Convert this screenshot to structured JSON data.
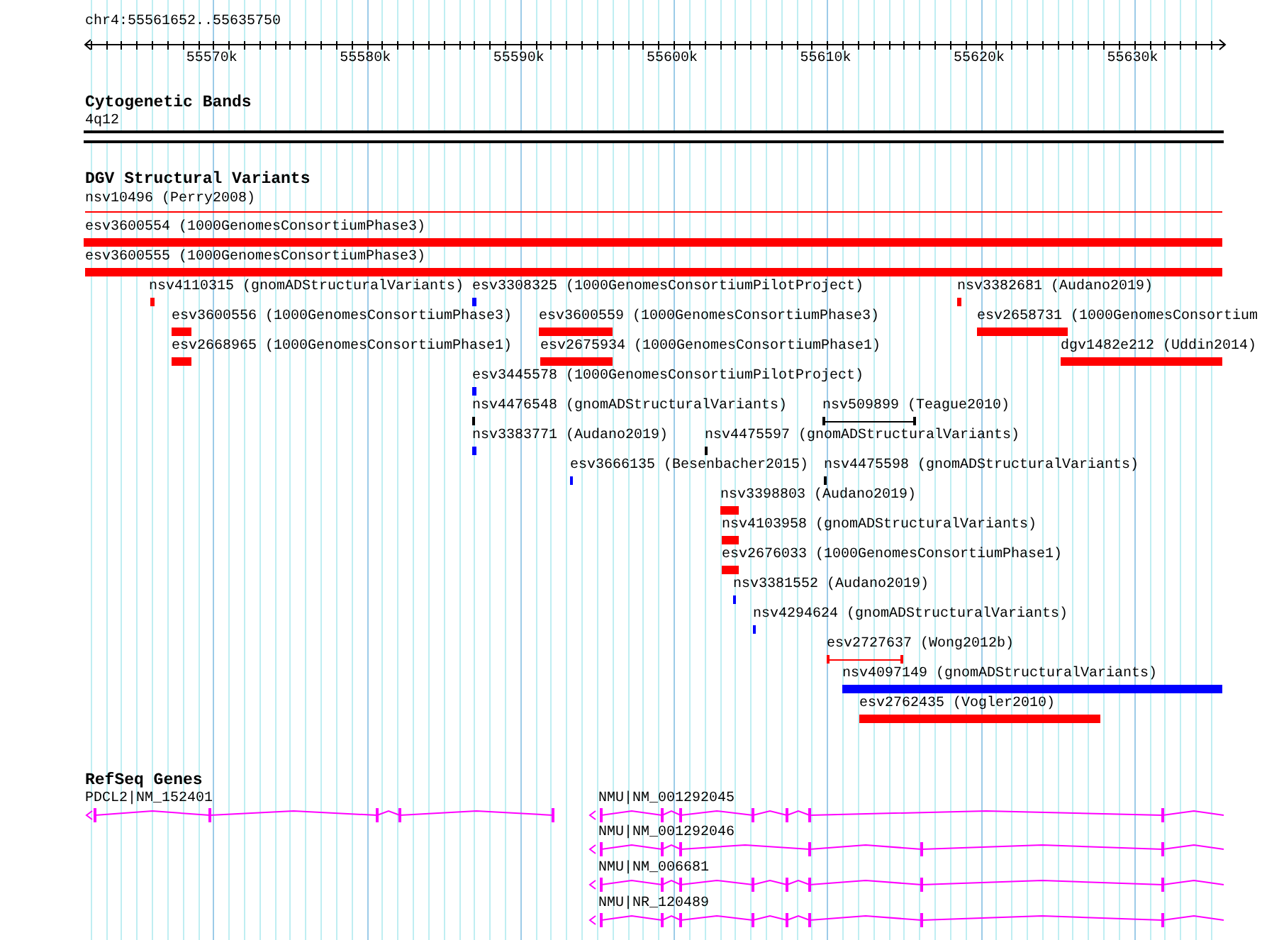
{
  "ruler": {
    "location": "chr4:55561652..55635750",
    "tick_labels": [
      "55570k",
      "55580k",
      "55590k",
      "55600k",
      "55610k",
      "55620k",
      "55630k"
    ]
  },
  "cytogenetic_bands": {
    "title": "Cytogenetic Bands",
    "band": "4q12"
  },
  "dgv_track": {
    "title": "DGV Structural Variants",
    "features": [
      {
        "label": "nsv10496 (Perry2008)",
        "kind": "line",
        "color": "#ff0000"
      },
      {
        "label": "esv3600554 (1000GenomesConsortiumPhase3)",
        "kind": "bar",
        "color": "#ff0000"
      },
      {
        "label": "esv3600555 (1000GenomesConsortiumPhase3)",
        "kind": "bar",
        "color": "#ff0000"
      },
      {
        "label": "nsv4110315 (gnomADStructuralVariants)",
        "kind": "bar",
        "color": "#ff0000"
      },
      {
        "label": "esv3308325 (1000GenomesConsortiumPilotProject)",
        "kind": "bar",
        "color": "#0000ff"
      },
      {
        "label": "nsv3382681 (Audano2019)",
        "kind": "bar",
        "color": "#ff0000"
      },
      {
        "label": "esv3600556 (1000GenomesConsortiumPhase3)",
        "kind": "bar",
        "color": "#ff0000"
      },
      {
        "label": "esv3600559 (1000GenomesConsortiumPhase3)",
        "kind": "bar",
        "color": "#ff0000"
      },
      {
        "label": "esv2658731 (1000GenomesConsortium",
        "kind": "bar",
        "color": "#ff0000"
      },
      {
        "label": "esv2668965 (1000GenomesConsortiumPhase1)",
        "kind": "bar",
        "color": "#ff0000"
      },
      {
        "label": "esv2675934 (1000GenomesConsortiumPhase1)",
        "kind": "bar",
        "color": "#ff0000"
      },
      {
        "label": "dgv1482e212 (Uddin2014)",
        "kind": "bar",
        "color": "#ff0000"
      },
      {
        "label": "esv3445578 (1000GenomesConsortiumPilotProject)",
        "kind": "bar",
        "color": "#0000ff"
      },
      {
        "label": "nsv4476548 (gnomADStructuralVariants)",
        "kind": "bar",
        "color": "#000000"
      },
      {
        "label": "nsv509899 (Teague2010)",
        "kind": "range",
        "color": "#000000"
      },
      {
        "label": "nsv3383771 (Audano2019)",
        "kind": "bar",
        "color": "#0000ff"
      },
      {
        "label": "nsv4475597 (gnomADStructuralVariants)",
        "kind": "bar",
        "color": "#000000"
      },
      {
        "label": "esv3666135 (Besenbacher2015)",
        "kind": "bar",
        "color": "#0000ff"
      },
      {
        "label": "nsv4475598 (gnomADStructuralVariants)",
        "kind": "bar",
        "color": "#000000"
      },
      {
        "label": "nsv3398803 (Audano2019)",
        "kind": "bar",
        "color": "#ff0000"
      },
      {
        "label": "nsv4103958 (gnomADStructuralVariants)",
        "kind": "bar",
        "color": "#ff0000"
      },
      {
        "label": "esv2676033 (1000GenomesConsortiumPhase1)",
        "kind": "bar",
        "color": "#ff0000"
      },
      {
        "label": "nsv3381552 (Audano2019)",
        "kind": "bar",
        "color": "#0000ff"
      },
      {
        "label": "nsv4294624 (gnomADStructuralVariants)",
        "kind": "bar",
        "color": "#0000ff"
      },
      {
        "label": "esv2727637 (Wong2012b)",
        "kind": "range",
        "color": "#ff0000"
      },
      {
        "label": "nsv4097149 (gnomADStructuralVariants)",
        "kind": "bar",
        "color": "#0000ff"
      },
      {
        "label": "esv2762435 (Vogler2010)",
        "kind": "bar",
        "color": "#ff0000"
      }
    ]
  },
  "refseq_track": {
    "title": "RefSeq Genes",
    "genes": [
      {
        "label": "PDCL2|NM_152401",
        "reverse_strand": true
      },
      {
        "label": "NMU|NM_001292045",
        "reverse_strand": true
      },
      {
        "label": "NMU|NM_001292046",
        "reverse_strand": true
      },
      {
        "label": "NMU|NM_006681",
        "reverse_strand": true
      },
      {
        "label": "NMU|NR_120489",
        "reverse_strand": true
      }
    ]
  }
}
